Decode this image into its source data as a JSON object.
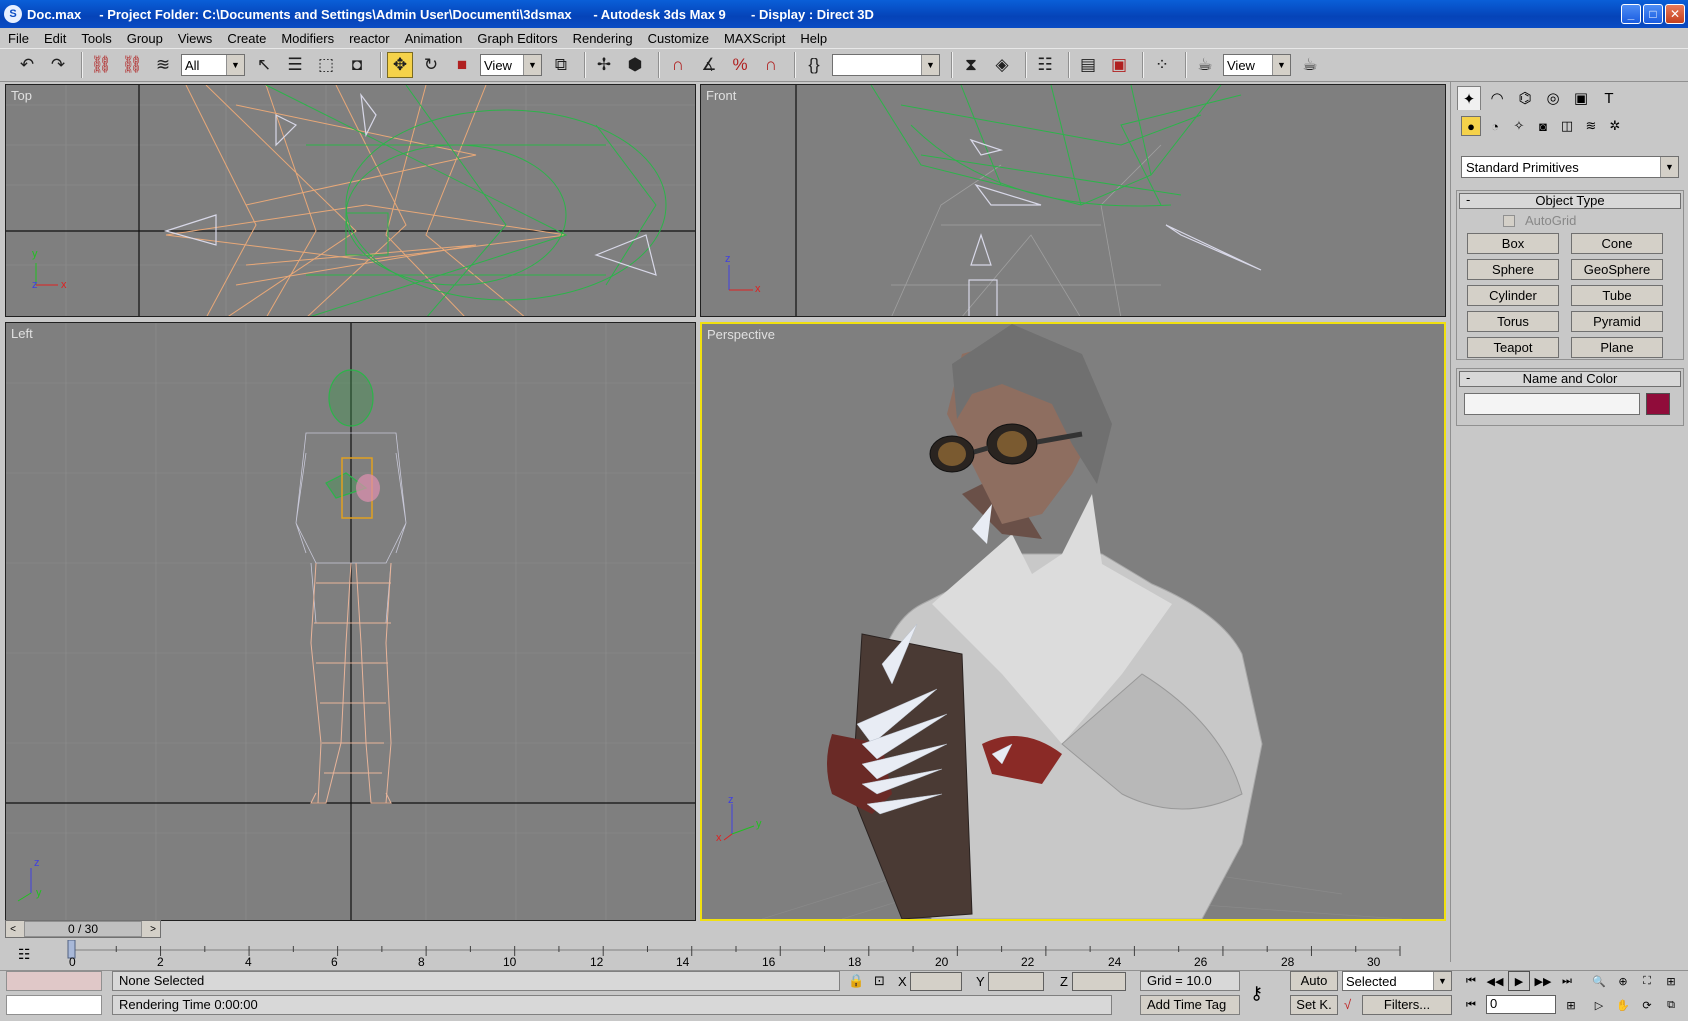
{
  "window": {
    "icon_letter": "S",
    "title": "Doc.max     - Project Folder: C:\\Documents and Settings\\Admin User\\Documenti\\3dsmax      - Autodesk 3ds Max 9       - Display : Direct 3D",
    "minimize": "_",
    "maximize": "□",
    "close": "✕"
  },
  "menu": [
    "File",
    "Edit",
    "Tools",
    "Group",
    "Views",
    "Create",
    "Modifiers",
    "reactor",
    "Animation",
    "Graph Editors",
    "Rendering",
    "Customize",
    "MAXScript",
    "Help"
  ],
  "toolbar": {
    "selection_filter": "All",
    "reference_coord": "View",
    "named_selection": "",
    "render_view": "View"
  },
  "viewports": {
    "top": {
      "label": "Top",
      "axis_a": "y",
      "axis_b": "x",
      "axis_c": "z"
    },
    "front": {
      "label": "Front",
      "axis_a": "z",
      "axis_b": "x"
    },
    "left": {
      "label": "Left",
      "axis_a": "z",
      "axis_b": "y"
    },
    "perspective": {
      "label": "Perspective",
      "axis_a": "z",
      "axis_b": "y",
      "axis_c": "x"
    }
  },
  "command_panel": {
    "dropdown": "Standard Primitives",
    "object_type_title": "Object Type",
    "collapse_symbol": "-",
    "autogrid": "AutoGrid",
    "primitives": [
      "Box",
      "Cone",
      "Sphere",
      "GeoSphere",
      "Cylinder",
      "Tube",
      "Torus",
      "Pyramid",
      "Teapot",
      "Plane"
    ],
    "name_color_title": "Name and Color",
    "object_name": "",
    "object_color": "#900c3a"
  },
  "timeline": {
    "slider_value": "0 / 30",
    "ticks": [
      "0",
      "2",
      "4",
      "6",
      "8",
      "10",
      "12",
      "14",
      "16",
      "18",
      "20",
      "22",
      "24",
      "26",
      "28",
      "30"
    ]
  },
  "status": {
    "selection": "None Selected",
    "prompt": "Rendering Time  0:00:00",
    "x_label": "X",
    "y_label": "Y",
    "z_label": "Z",
    "x_value": "",
    "y_value": "",
    "z_value": "",
    "grid": "Grid = 10.0",
    "auto_key": "Auto",
    "set_key": "Set K.",
    "key_filter": "Selected",
    "filters": "Filters...",
    "add_time_tag": "Add Time Tag",
    "current_frame": "0"
  }
}
